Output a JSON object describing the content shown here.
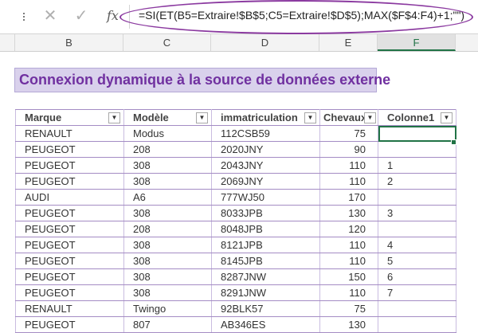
{
  "formula_bar": {
    "cancel_icon": "close-icon",
    "confirm_icon": "checkmark-icon",
    "fx_label": "fx",
    "formula": "=SI(ET(B5=Extraire!$B$5;C5=Extraire!$D$5);MAX($F$4:F4)+1;\"\")"
  },
  "columns": [
    "B",
    "C",
    "D",
    "E",
    "F"
  ],
  "selected_column": "F",
  "sheet": {
    "title": "Connexion dynamique à la source de données externe",
    "title_bg": "#d9d1ec",
    "title_color": "#7030a0",
    "table": {
      "headers": [
        "Marque",
        "Modèle",
        "immatriculation",
        "Chevaux",
        "Colonne1"
      ],
      "rows": [
        [
          "RENAULT",
          "Modus",
          "112CSB59",
          "75",
          ""
        ],
        [
          "PEUGEOT",
          "208",
          "2020JNY",
          "90",
          ""
        ],
        [
          "PEUGEOT",
          "308",
          "2043JNY",
          "110",
          "1"
        ],
        [
          "PEUGEOT",
          "308",
          "2069JNY",
          "110",
          "2"
        ],
        [
          "AUDI",
          "A6",
          "777WJ50",
          "170",
          ""
        ],
        [
          "PEUGEOT",
          "308",
          "8033JPB",
          "130",
          "3"
        ],
        [
          "PEUGEOT",
          "208",
          "8048JPB",
          "120",
          ""
        ],
        [
          "PEUGEOT",
          "308",
          "8121JPB",
          "110",
          "4"
        ],
        [
          "PEUGEOT",
          "308",
          "8145JPB",
          "110",
          "5"
        ],
        [
          "PEUGEOT",
          "308",
          "8287JNW",
          "150",
          "6"
        ],
        [
          "PEUGEOT",
          "308",
          "8291JNW",
          "110",
          "7"
        ],
        [
          "RENAULT",
          "Twingo",
          "92BLK57",
          "75",
          ""
        ],
        [
          "PEUGEOT",
          "807",
          "AB346ES",
          "130",
          ""
        ]
      ]
    }
  },
  "accent_color": "#217346",
  "annotation_color": "#8b3aa0"
}
